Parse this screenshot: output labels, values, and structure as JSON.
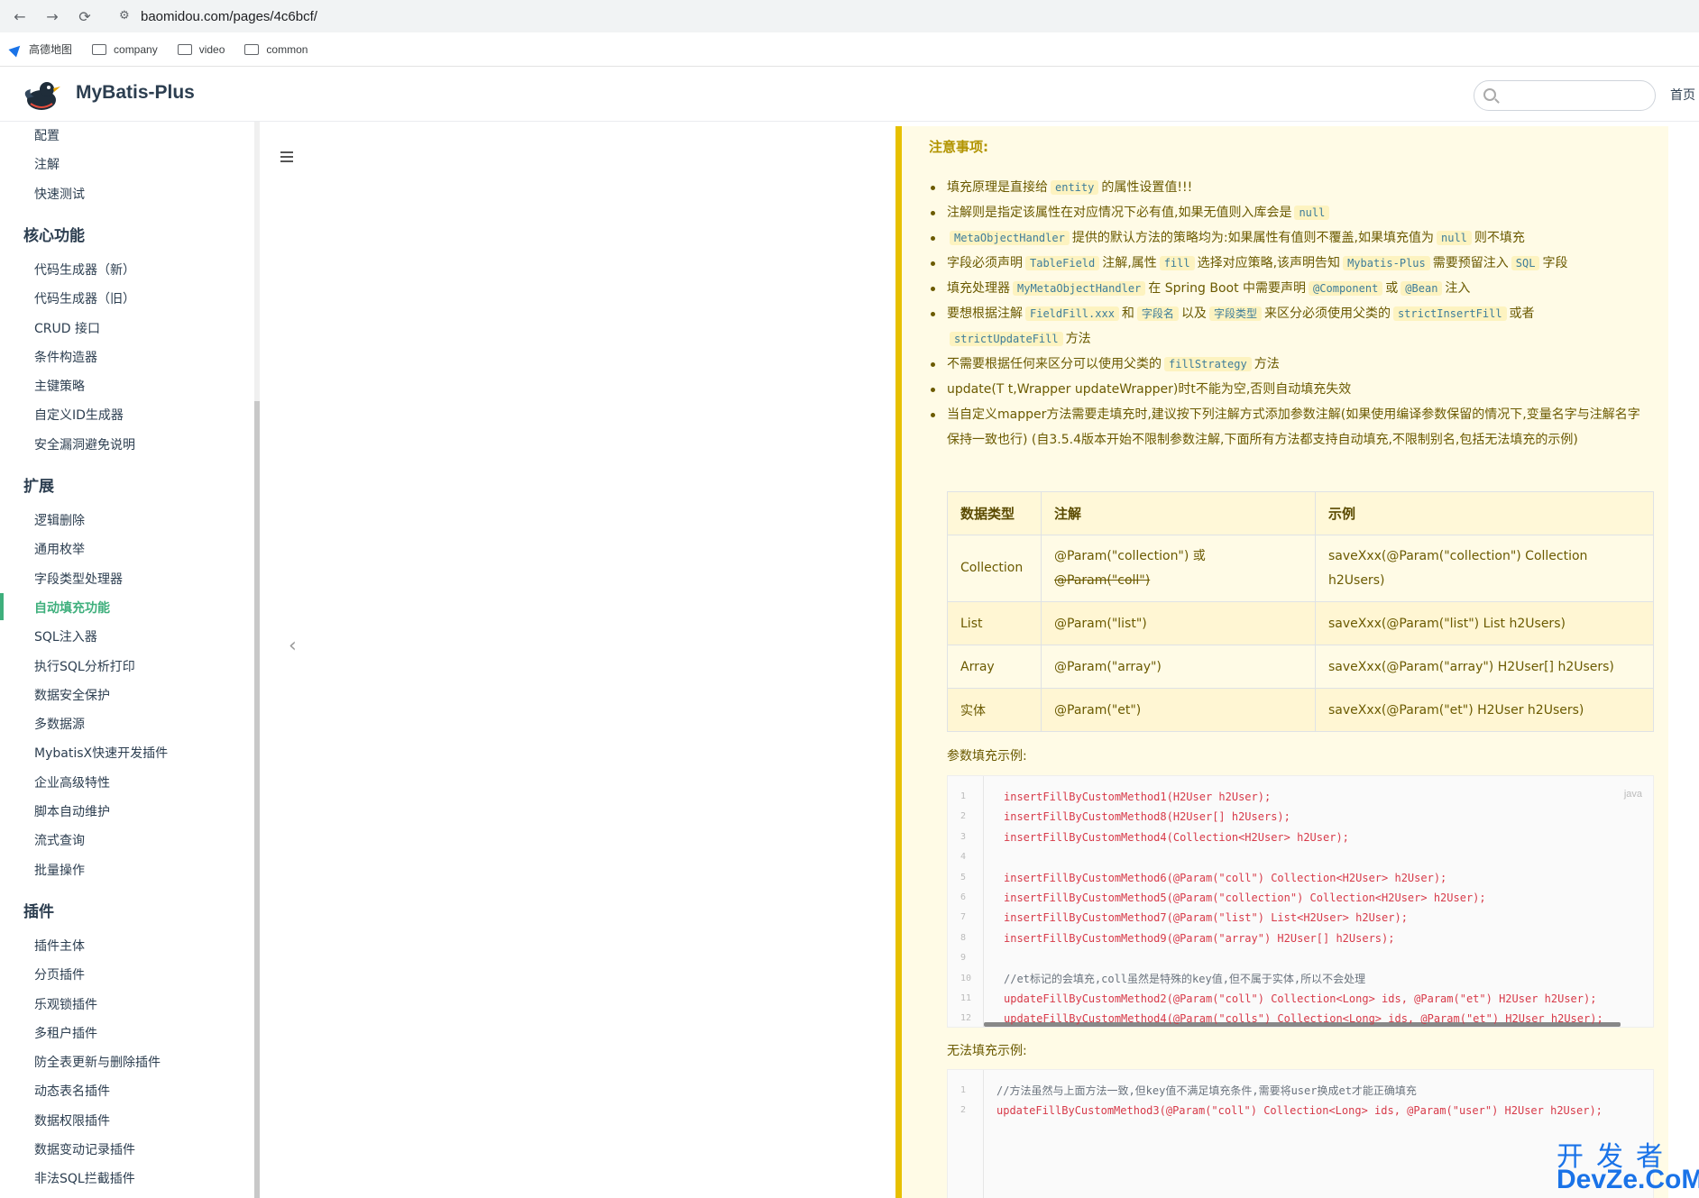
{
  "browser": {
    "url": "baomidou.com/pages/4c6bcf/",
    "back_icon": "←",
    "forward_icon": "→",
    "reload_icon": "⟳",
    "site_info_icon": "⚙",
    "bookmarks": [
      "高德地图",
      "company",
      "video",
      "common"
    ]
  },
  "navbar": {
    "site_name": "MyBatis-Plus",
    "search_placeholder": "",
    "home_link": "首页"
  },
  "sidebar": {
    "top_items": [
      "配置",
      "注解",
      "快速测试"
    ],
    "groups": [
      {
        "title": "核心功能",
        "items": [
          "代码生成器（新）",
          "代码生成器（旧）",
          "CRUD 接口",
          "条件构造器",
          "主键策略",
          "自定义ID生成器",
          "安全漏洞避免说明"
        ]
      },
      {
        "title": "扩展",
        "items": [
          "逻辑删除",
          "通用枚举",
          "字段类型处理器",
          "自动填充功能",
          "SQL注入器",
          "执行SQL分析打印",
          "数据安全保护",
          "多数据源",
          "MybatisX快速开发插件",
          "企业高级特性",
          "脚本自动维护",
          "流式查询",
          "批量操作"
        ]
      },
      {
        "title": "插件",
        "items": [
          "插件主体",
          "分页插件",
          "乐观锁插件",
          "多租户插件",
          "防全表更新与删除插件",
          "动态表名插件",
          "数据权限插件",
          "数据变动记录插件",
          "非法SQL拦截插件"
        ]
      }
    ],
    "active_item": "自动填充功能"
  },
  "content": {
    "warning_title": "注意事项:",
    "notes": [
      {
        "parts": [
          {
            "t": "填充原理是直接给"
          },
          {
            "c": "entity"
          },
          {
            "t": "的属性设置值!!!"
          }
        ]
      },
      {
        "parts": [
          {
            "t": "注解则是指定该属性在对应情况下必有值,如果无值则入库会是"
          },
          {
            "c": "null"
          }
        ]
      },
      {
        "parts": [
          {
            "c": "MetaObjectHandler"
          },
          {
            "t": "提供的默认方法的策略均为:如果属性有值则不覆盖,如果填充值为"
          },
          {
            "c": "null"
          },
          {
            "t": "则不填充"
          }
        ]
      },
      {
        "parts": [
          {
            "t": "字段必须声明"
          },
          {
            "c": "TableField"
          },
          {
            "t": "注解,属性"
          },
          {
            "c": "fill"
          },
          {
            "t": "选择对应策略,该声明告知"
          },
          {
            "c": "Mybatis-Plus"
          },
          {
            "t": "需要预留注入"
          },
          {
            "c": "SQL"
          },
          {
            "t": "字段"
          }
        ]
      },
      {
        "parts": [
          {
            "t": "填充处理器"
          },
          {
            "c": "MyMetaObjectHandler"
          },
          {
            "t": "在 Spring Boot 中需要声明"
          },
          {
            "c": "@Component"
          },
          {
            "t": "或"
          },
          {
            "c": "@Bean"
          },
          {
            "t": "注入"
          }
        ]
      },
      {
        "parts": [
          {
            "t": "要想根据注解"
          },
          {
            "c": "FieldFill.xxx"
          },
          {
            "t": "和"
          },
          {
            "c": "字段名"
          },
          {
            "t": "以及"
          },
          {
            "c": "字段类型"
          },
          {
            "t": "来区分必须使用父类的"
          },
          {
            "c": "strictInsertFill"
          },
          {
            "t": "或者"
          },
          {
            "c": "strictUpdateFill"
          },
          {
            "t": "方法"
          }
        ]
      },
      {
        "parts": [
          {
            "t": "不需要根据任何来区分可以使用父类的"
          },
          {
            "c": "fillStrategy"
          },
          {
            "t": "方法"
          }
        ]
      },
      {
        "parts": [
          {
            "t": "update(T t,Wrapper updateWrapper)时t不能为空,否则自动填充失效"
          }
        ]
      },
      {
        "parts": [
          {
            "t": "当自定义mapper方法需要走填充时,建议按下列注解方式添加参数注解(如果使用编译参数保留的情况下,变量名字与注解名字保持一致也行) (自3.5.4版本开始不限制参数注解,下面所有方法都支持自动填充,不限制别名,包括无法填充的示例)"
          }
        ]
      }
    ],
    "table": {
      "headers": [
        "数据类型",
        "注解",
        "示例"
      ],
      "rows": [
        {
          "type": "Collection",
          "anno": "@Param(\"collection\") 或",
          "anno_strike": "@Param(\"coll\")",
          "example": "saveXxx(@Param(\"collection\") Collection h2Users)"
        },
        {
          "type": "List",
          "anno": "@Param(\"list\")",
          "anno_strike": "",
          "example": "saveXxx(@Param(\"list\") List h2Users)"
        },
        {
          "type": "Array",
          "anno": "@Param(\"array\")",
          "anno_strike": "",
          "example": "saveXxx(@Param(\"array\") H2User[] h2Users)"
        },
        {
          "type": "实体",
          "anno": "@Param(\"et\")",
          "anno_strike": "",
          "example": "saveXxx(@Param(\"et\") H2User h2Users)"
        }
      ]
    },
    "param_fill_label": "参数填充示例:",
    "code_lang": "java",
    "code_lines": [
      "insertFillByCustomMethod1(H2User h2User);",
      "insertFillByCustomMethod8(H2User[] h2Users);",
      "insertFillByCustomMethod4(Collection<H2User> h2User);",
      "",
      "insertFillByCustomMethod6(@Param(\"coll\") Collection<H2User> h2User);",
      "insertFillByCustomMethod5(@Param(\"collection\") Collection<H2User> h2User);",
      "insertFillByCustomMethod7(@Param(\"list\") List<H2User> h2User);",
      "insertFillByCustomMethod9(@Param(\"array\") H2User[] h2Users);",
      "",
      "//et标记的会填充,coll虽然是特殊的key值,但不属于实体,所以不会处理",
      "updateFillByCustomMethod2(@Param(\"coll\") Collection<Long> ids, @Param(\"et\") H2User h2User);",
      "updateFillByCustomMethod4(@Param(\"colls\") Collection<Long> ids, @Param(\"et\") H2User h2User);",
      ""
    ],
    "no_fill_label": "无法填充示例:",
    "code2_lines": [
      "//方法虽然与上面方法一致,但key值不满足填充条件,需要将user换成et才能正确填充",
      "updateFillByCustomMethod3(@Param(\"coll\") Collection<Long> ids, @Param(\"user\") H2User h2User);"
    ]
  },
  "watermark": {
    "top": "开发者",
    "bottom": "DevZe.CoM"
  }
}
